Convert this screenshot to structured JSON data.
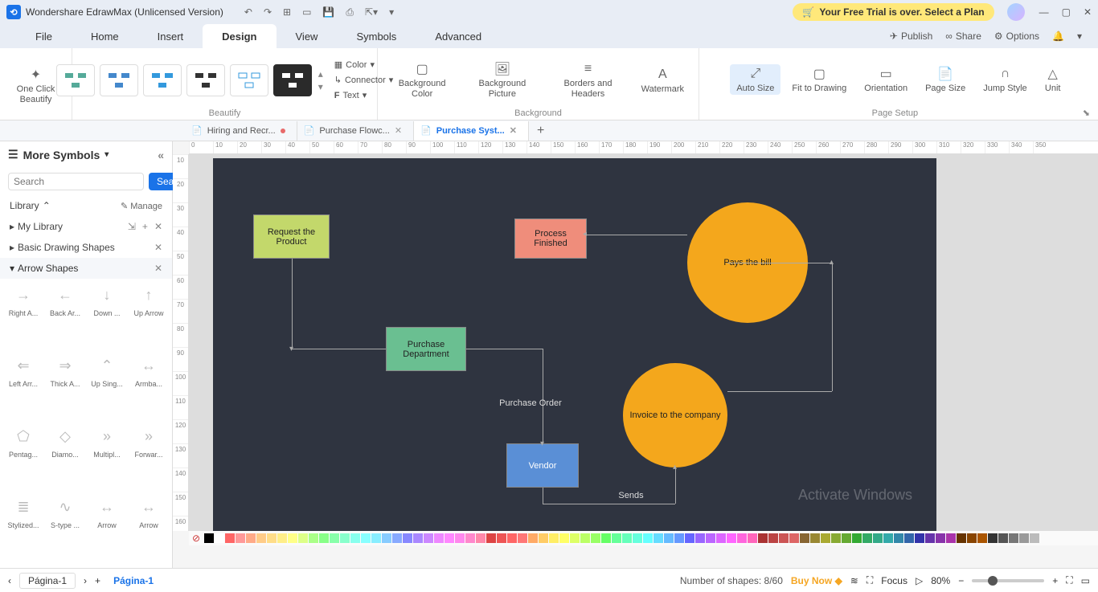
{
  "titlebar": {
    "app_name": "Wondershare EdrawMax (Unlicensed Version)",
    "trial_text": "Your Free Trial is over. Select a Plan"
  },
  "menu": {
    "items": [
      "File",
      "Home",
      "Insert",
      "Design",
      "View",
      "Symbols",
      "Advanced"
    ],
    "active": "Design",
    "publish": "Publish",
    "share": "Share",
    "options": "Options"
  },
  "ribbon": {
    "beautify": "One Click Beautify",
    "group_beautify": "Beautify",
    "color": "Color",
    "connector": "Connector",
    "text": "Text",
    "bg_color": "Background Color",
    "bg_picture": "Background Picture",
    "borders": "Borders and Headers",
    "watermark": "Watermark",
    "group_background": "Background",
    "auto_size": "Auto Size",
    "fit": "Fit to Drawing",
    "orientation": "Orientation",
    "page_size": "Page Size",
    "jump_style": "Jump Style",
    "unit": "Unit",
    "group_pagesetup": "Page Setup"
  },
  "tabs": [
    {
      "label": "Hiring and Recr...",
      "modified": true,
      "active": false
    },
    {
      "label": "Purchase Flowc...",
      "modified": false,
      "active": false
    },
    {
      "label": "Purchase Syst...",
      "modified": false,
      "active": true
    }
  ],
  "left": {
    "title": "More Symbols",
    "search_placeholder": "Search",
    "search_btn": "Search",
    "library": "Library",
    "manage": "Manage",
    "mylib": "My Library",
    "basic": "Basic Drawing Shapes",
    "arrows": "Arrow Shapes",
    "shapes": [
      "Right A...",
      "Back Ar...",
      "Down ...",
      "Up Arrow",
      "Left Arr...",
      "Thick A...",
      "Up Sing...",
      "Armba...",
      "Pentag...",
      "Diamo...",
      "Multipl...",
      "Forwar...",
      "Stylized...",
      "S-type ...",
      "Arrow",
      "Arrow"
    ]
  },
  "flow": {
    "request": "Request the Product",
    "purchase_dept": "Purchase Department",
    "po": "Purchase Order",
    "vendor": "Vendor",
    "sends": "Sends",
    "invoice": "Invoice to the company",
    "pays": "Pays the bill",
    "process_finished": "Process Finished"
  },
  "status": {
    "page_selector": "Página-1",
    "page_label": "Página-1",
    "shapes": "Number of shapes: 8/60",
    "buy": "Buy Now",
    "focus": "Focus",
    "zoom": "80%"
  },
  "watermark": "Activate Windows",
  "colors": [
    "#000",
    "#fff",
    "#f66",
    "#f99",
    "#fa8",
    "#fc8",
    "#fd8",
    "#fe8",
    "#ff8",
    "#df8",
    "#af8",
    "#8f8",
    "#8fa",
    "#8fc",
    "#8fe",
    "#8ff",
    "#8ef",
    "#8cf",
    "#8af",
    "#88f",
    "#a8f",
    "#c8f",
    "#e8f",
    "#f8f",
    "#f8e",
    "#f8c",
    "#f8a",
    "#d44",
    "#e55",
    "#f66",
    "#f77",
    "#fa6",
    "#fc6",
    "#fe6",
    "#ff6",
    "#df6",
    "#bf6",
    "#9f6",
    "#6f6",
    "#6f9",
    "#6fb",
    "#6fd",
    "#6ff",
    "#6df",
    "#6bf",
    "#69f",
    "#66f",
    "#96f",
    "#b6f",
    "#d6f",
    "#f6f",
    "#f6d",
    "#f6b",
    "#a33",
    "#b44",
    "#c55",
    "#d66",
    "#863",
    "#983",
    "#aa3",
    "#8a3",
    "#6a3",
    "#3a3",
    "#3a6",
    "#3a8",
    "#3aa",
    "#38a",
    "#36a",
    "#33a",
    "#63a",
    "#83a",
    "#a3a",
    "#630",
    "#840",
    "#a50",
    "#333",
    "#555",
    "#777",
    "#999",
    "#bbb"
  ]
}
